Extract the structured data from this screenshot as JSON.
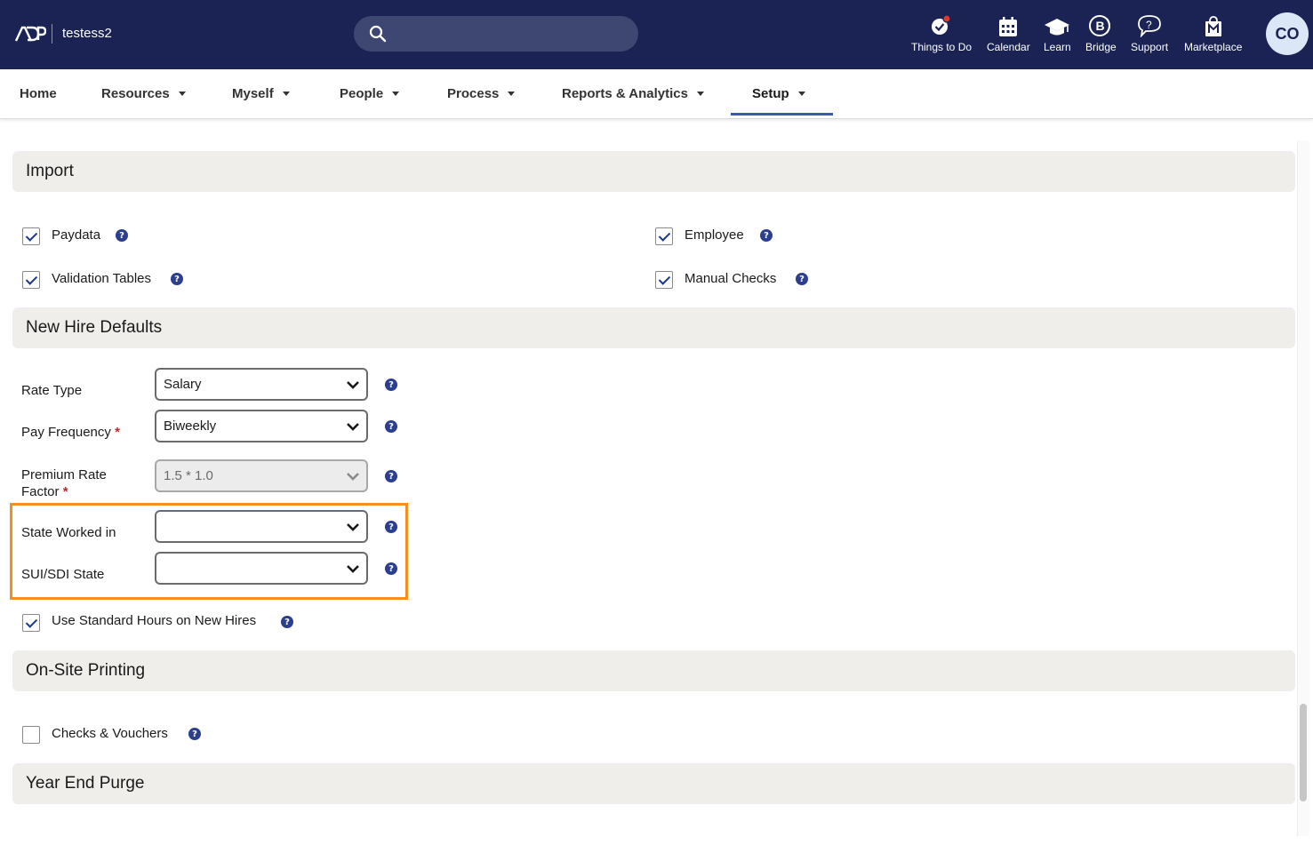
{
  "header": {
    "client_name": "testess2",
    "nav": [
      {
        "label": "Things to Do",
        "icon": "check-badge-icon"
      },
      {
        "label": "Calendar",
        "icon": "calendar-icon"
      },
      {
        "label": "Learn",
        "icon": "graduation-cap-icon"
      },
      {
        "label": "Bridge",
        "icon": "bridge-icon"
      },
      {
        "label": "Support",
        "icon": "help-bubble-icon"
      },
      {
        "label": "Marketplace",
        "icon": "store-bag-icon"
      }
    ],
    "avatar_initials": "CO",
    "colors": {
      "bar": "#1a2354",
      "notification": "#e0392b"
    }
  },
  "menu": {
    "items": [
      "Home",
      "Resources",
      "Myself",
      "People",
      "Process",
      "Reports & Analytics",
      "Setup"
    ],
    "active": "Setup"
  },
  "sections": {
    "import": {
      "title": "Import",
      "options": [
        {
          "label": "Paydata",
          "checked": true
        },
        {
          "label": "Employee",
          "checked": true
        },
        {
          "label": "Validation Tables",
          "checked": true
        },
        {
          "label": "Manual Checks",
          "checked": true
        }
      ]
    },
    "new_hire": {
      "title": "New Hire Defaults",
      "fields": {
        "rate_type": {
          "label": "Rate Type",
          "value": "Salary"
        },
        "pay_frequency": {
          "label": "Pay Frequency",
          "value": "Biweekly",
          "required": "*"
        },
        "premium_rate": {
          "label_line1": "Premium Rate",
          "label_line2": "Factor",
          "value": "1.5 * 1.0",
          "required": "*"
        },
        "state_worked": {
          "label": "State Worked in",
          "value": ""
        },
        "sui_sdi": {
          "label": "SUI/SDI State",
          "value": ""
        }
      },
      "standard_hours": {
        "label": "Use Standard Hours on New Hires",
        "checked": true
      }
    },
    "onsite": {
      "title": "On-Site Printing",
      "checks_vouchers": {
        "label": "Checks & Vouchers",
        "checked": false
      }
    },
    "year_end": {
      "title": "Year End Purge"
    }
  },
  "help_glyph": "?"
}
